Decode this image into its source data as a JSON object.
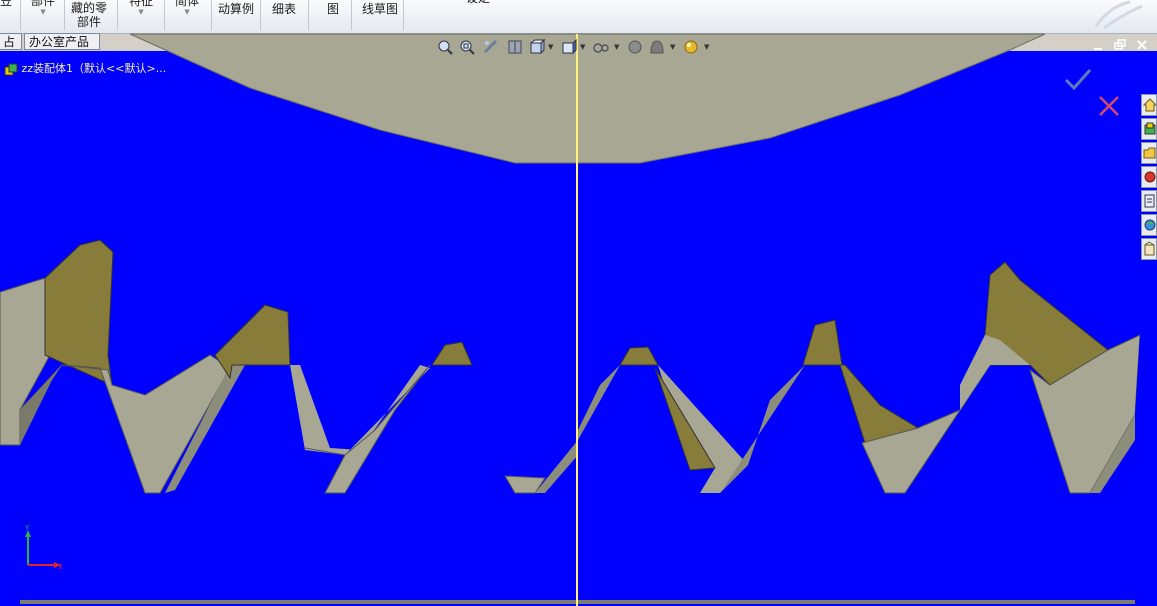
{
  "ribbon": {
    "items": [
      {
        "label": "笠",
        "name": "ribbon-cut-0"
      },
      {
        "label": "部件",
        "name": "ribbon-parts"
      },
      {
        "label": "藏的零\n部件",
        "name": "ribbon-hidden-parts"
      },
      {
        "label": "特征",
        "name": "ribbon-features"
      },
      {
        "label": "简体",
        "name": "ribbon-simplify"
      },
      {
        "label": "动算例",
        "name": "ribbon-motion-study"
      },
      {
        "label": "细表",
        "name": "ribbon-bom"
      },
      {
        "label": "图",
        "name": "ribbon-view"
      },
      {
        "label": "线草图",
        "name": "ribbon-sketch"
      },
      {
        "label": "设定",
        "name": "ribbon-settings"
      }
    ]
  },
  "tabs": {
    "tab1": "占",
    "tab2": "办公室产品"
  },
  "tree": {
    "root_label": "zz装配体1（默认<<默认>..."
  },
  "colors": {
    "background": "#0000ff",
    "gear_face": "#a7a794",
    "gear_flank": "#877c3a",
    "section_line": "#fff27a"
  },
  "icons": {
    "hud": [
      "zoom-to-fit-icon",
      "zoom-area-icon",
      "previous-view-icon",
      "section-view-icon",
      "view-orientation-icon",
      "display-style-icon",
      "hide-show-icon",
      "edit-appearance-icon",
      "apply-scene-icon",
      "realview-icon"
    ],
    "confirm": "checkmark-icon",
    "cancel": "close-x-icon",
    "taskpane": [
      "home-icon",
      "design-library-icon",
      "file-explorer-icon",
      "view-palette-icon",
      "appearances-icon",
      "custom-properties-icon",
      "search-icon"
    ]
  }
}
